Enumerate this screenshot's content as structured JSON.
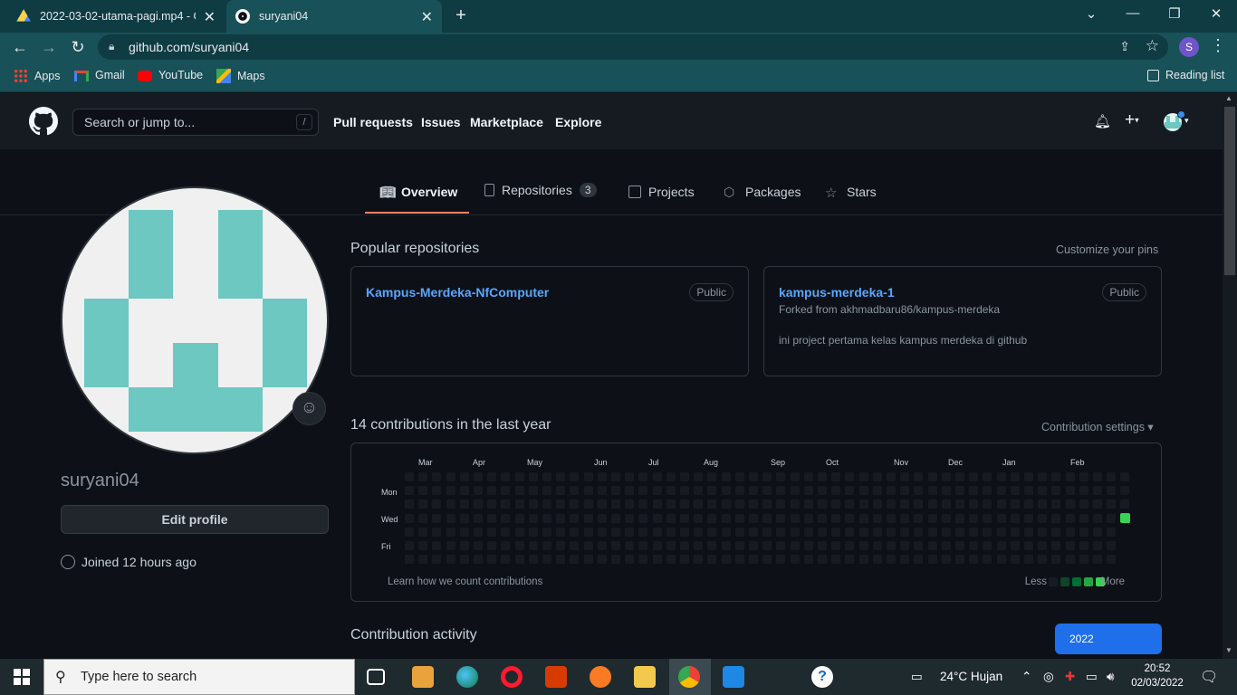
{
  "browser": {
    "tabs": [
      {
        "title": "2022-03-02-utama-pagi.mp4 - G",
        "active": false
      },
      {
        "title": "suryani04",
        "active": true
      }
    ],
    "url": "github.com/suryani04",
    "profile_initial": "S",
    "bookmarks": [
      "Apps",
      "Gmail",
      "YouTube",
      "Maps"
    ],
    "reading_list": "Reading list"
  },
  "github": {
    "search_placeholder": "Search or jump to...",
    "search_key": "/",
    "nav": [
      "Pull requests",
      "Issues",
      "Marketplace",
      "Explore"
    ],
    "profile_tabs": [
      {
        "label": "Overview",
        "icon": "book-icon"
      },
      {
        "label": "Repositories",
        "icon": "repo-icon",
        "count": "3"
      },
      {
        "label": "Projects",
        "icon": "project-icon"
      },
      {
        "label": "Packages",
        "icon": "package-icon"
      },
      {
        "label": "Stars",
        "icon": "star-icon"
      }
    ],
    "username": "suryani04",
    "edit_profile": "Edit profile",
    "joined": "Joined 12 hours ago",
    "popular_title": "Popular repositories",
    "customize_pins": "Customize your pins",
    "repos": [
      {
        "name": "Kampus-Merdeka-NfComputer",
        "visibility": "Public",
        "fork": "",
        "description": ""
      },
      {
        "name": "kampus-merdeka-1",
        "visibility": "Public",
        "fork": "Forked from akhmadbaru86/kampus-merdeka",
        "description": "ini project pertama kelas kampus merdeka di github"
      }
    ],
    "contributions_title": "14 contributions in the last year",
    "contribution_settings": "Contribution settings",
    "months": [
      "Mar",
      "Apr",
      "May",
      "Jun",
      "Jul",
      "Aug",
      "Sep",
      "Oct",
      "Nov",
      "Dec",
      "Jan",
      "Feb"
    ],
    "day_labels": [
      "Mon",
      "Wed",
      "Fri"
    ],
    "learn_link": "Learn how we count contributions",
    "legend_less": "Less",
    "legend_more": "More",
    "activity_title": "Contribution activity",
    "year": "2022",
    "colors": {
      "empty": "#161b22",
      "level4": "#39d353",
      "accent": "#f78166",
      "link": "#58a6ff"
    }
  },
  "taskbar": {
    "search_placeholder": "Type here to search",
    "weather": "24°C  Hujan",
    "time": "20:52",
    "date": "02/03/2022"
  }
}
